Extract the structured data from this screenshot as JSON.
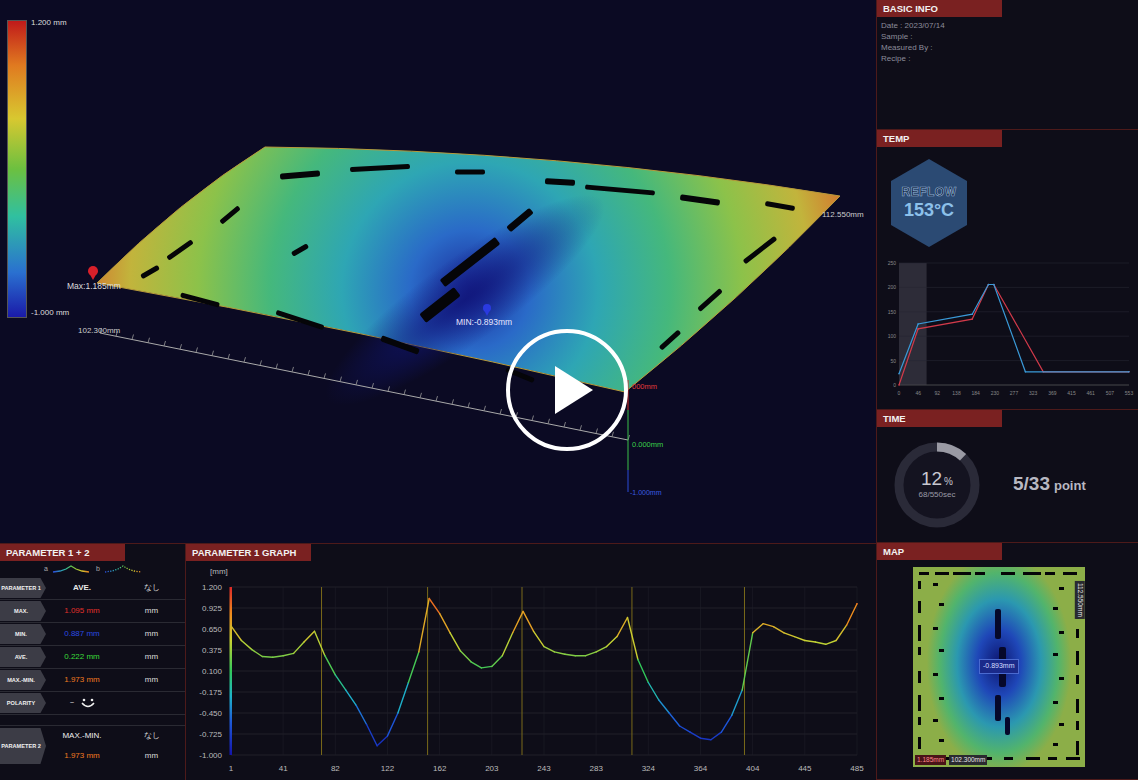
{
  "view3d": {
    "color_scale": {
      "max": "1.200 mm",
      "min": "-1.000 mm"
    },
    "max_label": "Max:1.185mm",
    "min_label": "MIN:-0.893mm",
    "x_length": "102.300mm",
    "y_length": "112.550mm",
    "z_top": "000mm",
    "z_zero": "0.000mm",
    "z_bottom": "-1.000mm"
  },
  "basic_info": {
    "title": "BASIC INFO",
    "lines": [
      "Date : 2023/07/14",
      "Sample :",
      "Measured By :",
      "Recipe :"
    ]
  },
  "temp": {
    "title": "TEMP",
    "mode": "REFLOW",
    "value": "153°C",
    "y_ticks": [
      "0",
      "50",
      "100",
      "150",
      "200",
      "250"
    ],
    "x_ticks": [
      "0",
      "46",
      "92",
      "138",
      "184",
      "230",
      "277",
      "323",
      "369",
      "415",
      "461",
      "507",
      "553"
    ],
    "y_max": 250,
    "x_max": 553,
    "series": [
      {
        "color": "#d23a4a",
        "points": [
          [
            0,
            0
          ],
          [
            46,
            115
          ],
          [
            176,
            135
          ],
          [
            215,
            206
          ],
          [
            228,
            206
          ],
          [
            347,
            27
          ],
          [
            553,
            27
          ]
        ]
      },
      {
        "color": "#3a9ad8",
        "points": [
          [
            0,
            23
          ],
          [
            46,
            125
          ],
          [
            176,
            145
          ],
          [
            215,
            206
          ],
          [
            228,
            206
          ],
          [
            304,
            27
          ],
          [
            553,
            27
          ]
        ]
      }
    ]
  },
  "time": {
    "title": "TIME",
    "percent": "12",
    "percent_sign": "%",
    "elapsed": "68/550sec",
    "level": 0.12,
    "points": "5/33",
    "points_label": "point"
  },
  "parameters": {
    "title": "PARAMETER 1 + 2",
    "legend": [
      {
        "label": "a",
        "kind": "solid"
      },
      {
        "label": "b",
        "kind": "dotted"
      }
    ],
    "rows": [
      {
        "label": "PARAMETER 1",
        "value": "AVE.",
        "unit": "なし",
        "color": "#e8e8e8",
        "kind": "header"
      },
      {
        "label": "MAX.",
        "value": "1.095 mm",
        "unit": "mm",
        "color": "#e0302a",
        "kind": "value"
      },
      {
        "label": "MIN.",
        "value": "0.887 mm",
        "unit": "mm",
        "color": "#2a4ae0",
        "kind": "value"
      },
      {
        "label": "AVE.",
        "value": "0.222 mm",
        "unit": "mm",
        "color": "#3adc3a",
        "kind": "value"
      },
      {
        "label": "MAX.-MIN.",
        "value": "1.973 mm",
        "unit": "mm",
        "color": "#f07a20",
        "kind": "value"
      },
      {
        "label": "POLARITY",
        "value": "－",
        "color": "#e8e8e8",
        "kind": "polarity"
      }
    ],
    "parameter2": {
      "label": "PARAMETER 2",
      "name": "MAX.-MIN.",
      "none": "なし",
      "value": "1.973 mm",
      "unit": "mm"
    }
  },
  "graph": {
    "title": "PARAMETER 1 GRAPH",
    "unit": "[mm]",
    "y_ticks": [
      "1.200",
      "0.925",
      "0.650",
      "0.375",
      "0.100",
      "-0.175",
      "-0.450",
      "-0.725",
      "-1.000"
    ],
    "x_ticks": [
      "1",
      "41",
      "82",
      "122",
      "162",
      "203",
      "243",
      "283",
      "324",
      "364",
      "404",
      "445",
      "485"
    ],
    "y_range": [
      -1.0,
      1.2
    ],
    "x_range": [
      1,
      485
    ],
    "markers": [
      71,
      153,
      226,
      311,
      398
    ],
    "values": [
      0.69,
      0.5,
      0.38,
      0.29,
      0.28,
      0.3,
      0.33,
      0.48,
      0.62,
      0.3,
      0.05,
      -0.15,
      -0.35,
      -0.6,
      -0.88,
      -0.75,
      -0.45,
      -0.05,
      0.35,
      1.05,
      0.85,
      0.6,
      0.36,
      0.22,
      0.14,
      0.16,
      0.3,
      0.6,
      0.88,
      0.62,
      0.42,
      0.35,
      0.32,
      0.3,
      0.3,
      0.35,
      0.42,
      0.55,
      0.8,
      0.25,
      -0.05,
      -0.28,
      -0.45,
      -0.62,
      -0.7,
      -0.78,
      -0.8,
      -0.7,
      -0.48,
      -0.15,
      0.6,
      0.72,
      0.68,
      0.6,
      0.55,
      0.5,
      0.48,
      0.45,
      0.5,
      0.7,
      0.98
    ]
  },
  "map": {
    "title": "MAP",
    "min_label": "-0.893mm",
    "max_label": "1.185mm",
    "width_label": "102.300mm",
    "height_label": "112.550mm"
  }
}
